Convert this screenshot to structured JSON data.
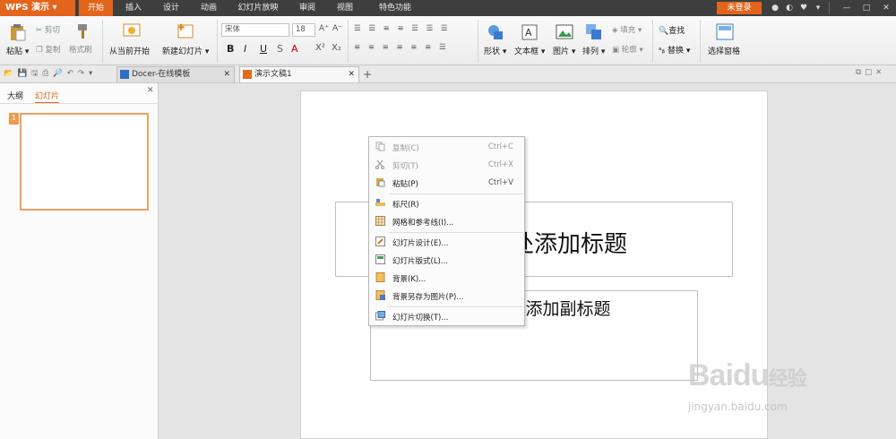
{
  "app": {
    "name": "WPS 演示",
    "login": "未登录"
  },
  "menu_tabs": [
    "开始",
    "插入",
    "设计",
    "动画",
    "幻灯片放映",
    "审阅",
    "视图",
    "特色功能"
  ],
  "ribbon": {
    "paste": "粘贴",
    "cut": "剪切",
    "copy": "复制",
    "format_painter": "格式刷",
    "from_current": "从当前开始",
    "new_slide": "新建幻灯片",
    "font": "宋体",
    "font_size": "18",
    "shape": "形状",
    "textbox": "文本框",
    "picture": "图片",
    "arrange": "排列",
    "fill": "填充",
    "outline": "轮廓",
    "find": "查找",
    "replace": "替换",
    "selection_pane": "选择窗格"
  },
  "doc_tabs": [
    {
      "title": "Docer-在线模板"
    },
    {
      "title": "演示文稿1"
    }
  ],
  "left_pane": {
    "tab_outline": "大纲",
    "tab_slides": "幻灯片",
    "slide_num": "1"
  },
  "slide": {
    "title_text": "单击此处添加标题",
    "subtitle_text": "单击此处添加副标题"
  },
  "context_menu": [
    {
      "label": "复制(C)",
      "shortcut": "Ctrl+C",
      "disabled": true,
      "icon": "copy-icon"
    },
    {
      "label": "剪切(T)",
      "shortcut": "Ctrl+X",
      "disabled": true,
      "icon": "cut-icon"
    },
    {
      "label": "粘贴(P)",
      "shortcut": "Ctrl+V",
      "disabled": false,
      "icon": "paste-icon"
    },
    {
      "label": "标尺(R)",
      "shortcut": "",
      "disabled": false,
      "icon": "ruler-icon"
    },
    {
      "label": "网格和参考线(I)...",
      "shortcut": "",
      "disabled": false,
      "icon": "grid-icon"
    },
    {
      "label": "幻灯片设计(E)...",
      "shortcut": "",
      "disabled": false,
      "icon": "slide-design-icon"
    },
    {
      "label": "幻灯片版式(L)...",
      "shortcut": "",
      "disabled": false,
      "icon": "slide-layout-icon"
    },
    {
      "label": "背景(K)...",
      "shortcut": "",
      "disabled": false,
      "icon": "background-icon"
    },
    {
      "label": "背景另存为图片(P)...",
      "shortcut": "",
      "disabled": false,
      "icon": "save-bg-icon"
    },
    {
      "label": "幻灯片切换(T)...",
      "shortcut": "",
      "disabled": false,
      "icon": "transition-icon"
    }
  ],
  "watermark": {
    "brand": "Baidu",
    "cn": "经验",
    "url": "jingyan.baidu.com"
  }
}
